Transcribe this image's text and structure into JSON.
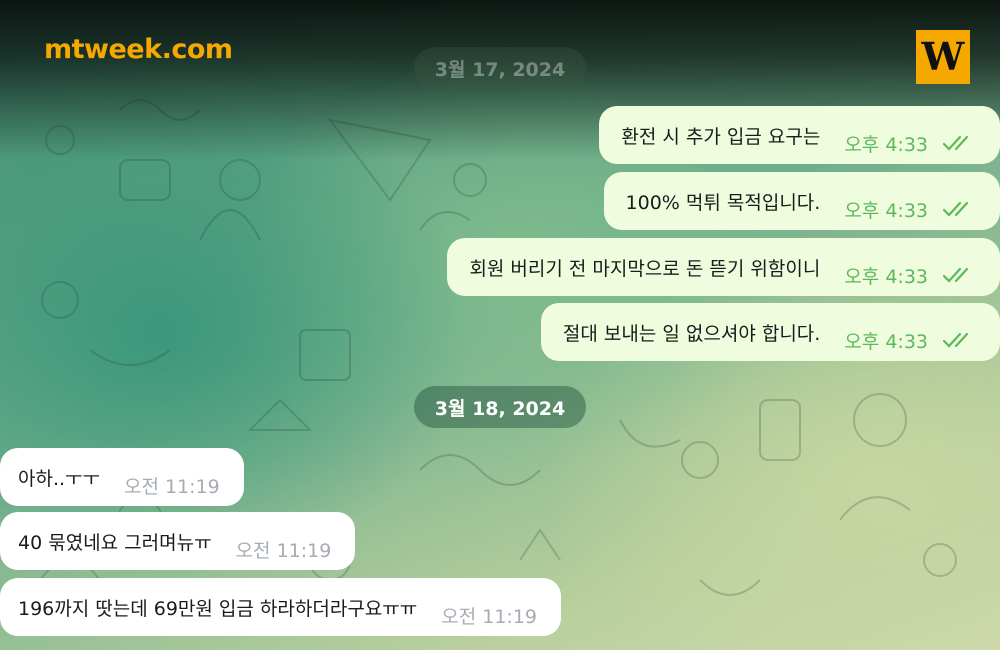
{
  "brand": {
    "site": "mtweek.com",
    "badge_letter": "W"
  },
  "chat": {
    "date_1": "3월 17, 2024",
    "date_2": "3월 18, 2024",
    "outgoing": [
      {
        "text": "환전 시 추가 입금 요구는",
        "time": "오후 4:33"
      },
      {
        "text": "100% 먹튀 목적입니다.",
        "time": "오후 4:33"
      },
      {
        "text": "회원 버리기 전 마지막으로 돈 뜯기 위함이니",
        "time": "오후 4:33"
      },
      {
        "text": "절대 보내는 일 없으셔야 합니다.",
        "time": "오후 4:33"
      }
    ],
    "incoming": [
      {
        "text": "아하..ㅜㅜ",
        "time": "오전 11:19"
      },
      {
        "text": "40 묶였네요 그러며뉴ㅠ",
        "time": "오전 11:19"
      },
      {
        "text": "196까지 땃는데 69만원 입금 하라하더라구요ㅠㅠ",
        "time": "오전 11:19"
      }
    ],
    "read_icon": "double-check-icon",
    "colors": {
      "accent": "#f5a800",
      "outgoing_bg": "#effdde",
      "incoming_bg": "#ffffff",
      "read_check": "#5cb85c"
    }
  }
}
